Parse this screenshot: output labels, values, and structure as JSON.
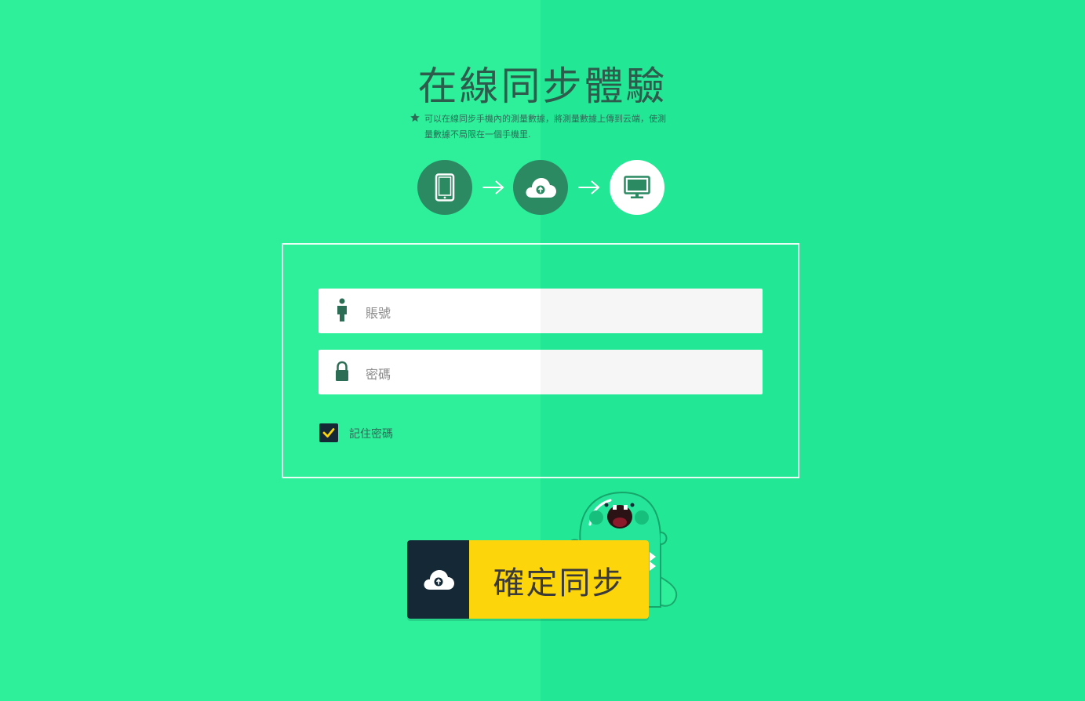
{
  "header": {
    "title": "在線同步體驗",
    "description": "可以在線同步手機內的測量數據，將測量數據上傳到云端，使測量數據不局限在一個手機里."
  },
  "steps": [
    {
      "icon": "tablet-icon"
    },
    {
      "icon": "cloud-upload-icon"
    },
    {
      "icon": "monitor-icon"
    }
  ],
  "form": {
    "account_placeholder": "賬號",
    "password_placeholder": "密碼",
    "remember_label": "記住密碼",
    "remember_checked": true
  },
  "sync_button": {
    "label": "確定同步",
    "icon": "cloud-upload-icon"
  },
  "colors": {
    "background": "#2ef09b",
    "dark_circle": "#2c8a63",
    "button_dark": "#142836",
    "button_yellow": "#fcd50a",
    "check_yellow": "#fcd50a"
  }
}
